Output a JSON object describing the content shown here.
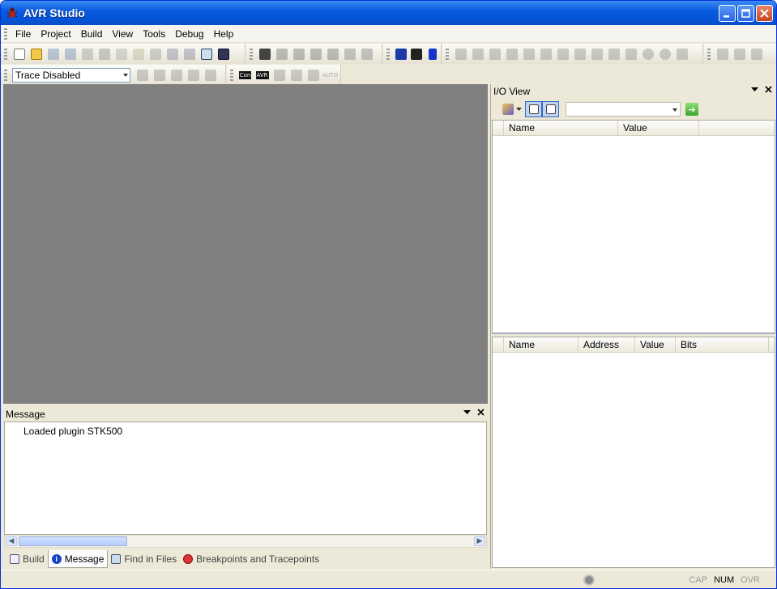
{
  "window": {
    "title": "AVR Studio"
  },
  "menu": [
    "File",
    "Project",
    "Build",
    "View",
    "Tools",
    "Debug",
    "Help"
  ],
  "trace_combo": {
    "value": "Trace Disabled"
  },
  "toolbar_text": {
    "con": "Con",
    "avr": "AVR",
    "auto": "AUTO"
  },
  "io_view": {
    "title": "I/O View",
    "top_columns": [
      "Name",
      "Value"
    ],
    "bottom_columns": [
      "Name",
      "Address",
      "Value",
      "Bits"
    ]
  },
  "message_panel": {
    "title": "Message",
    "lines": [
      "Loaded plugin STK500"
    ]
  },
  "bottom_tabs": [
    "Build",
    "Message",
    "Find in Files",
    "Breakpoints and Tracepoints"
  ],
  "status": {
    "cap": "CAP",
    "num": "NUM",
    "ovr": "OVR"
  },
  "colors": {
    "title_bar": "#0a5be0",
    "editor_bg": "#808080",
    "xp_face": "#ece9d8"
  }
}
